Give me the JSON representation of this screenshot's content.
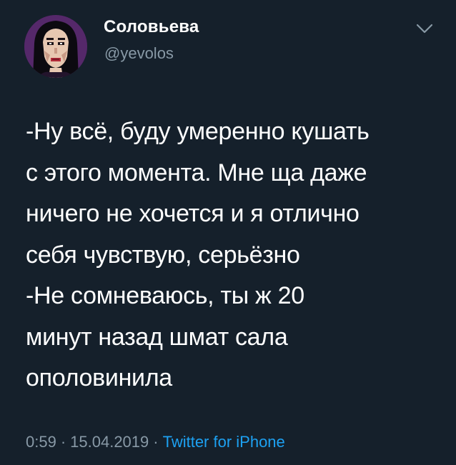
{
  "user": {
    "display_name": "Соловьева",
    "handle": "@yevolos",
    "avatar_icon": "pixel-art-portrait-avatar"
  },
  "menu_icon": "chevron-down-icon",
  "tweet": {
    "lines": [
      "-Ну всё, буду умеренно кушать",
      "с этого момента. Мне ща даже",
      "ничего не хочется и я отлично",
      "себя чувствую, серьёзно",
      "-Не сомневаюсь, ты ж 20",
      "минут назад шмат сала",
      "ополовинила"
    ]
  },
  "meta": {
    "time": "0:59",
    "separator": "·",
    "date": "15.04.2019",
    "source": "Twitter for iPhone"
  },
  "colors": {
    "background": "#15202b",
    "primary_text": "#ffffff",
    "secondary_text": "#8899a6",
    "link": "#1da1f2"
  }
}
